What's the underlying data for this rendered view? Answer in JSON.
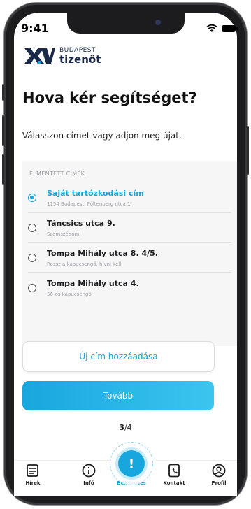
{
  "status": {
    "time": "9:41",
    "wifi_icon": "wifi-icon",
    "battery_icon": "battery-icon"
  },
  "brand": {
    "line1": "BUDAPEST",
    "line2": "tizenöt",
    "logo_colors": [
      "#1b2a4a",
      "#1aa3dc"
    ]
  },
  "page": {
    "title": "Hova kér segítséget?",
    "subtitle": "Válasszon címet vagy adjon meg újat."
  },
  "saved_addresses": {
    "header": "ELMENTETT CÍMEK",
    "items": [
      {
        "label": "Saját tartózkodási cím",
        "detail": "1154 Budapest, Pöltenberg utca 1.",
        "selected": true
      },
      {
        "label": "Táncsics utca 9.",
        "detail": "Szomszédom",
        "selected": false
      },
      {
        "label": "Tompa Mihály utca 8. 4/5.",
        "detail": "Rossz a kapucsengő, hívni kell",
        "selected": false
      },
      {
        "label": "Tompa Mihály utca 4.",
        "detail": "56-os kapucsengő",
        "selected": false
      }
    ]
  },
  "actions": {
    "add_new": "Új cím hozzáadása",
    "next": "Tovább"
  },
  "pager": {
    "current": "3",
    "total": "/4"
  },
  "tabbar": {
    "items": [
      {
        "label": "Hírek",
        "icon": "newspaper-icon"
      },
      {
        "label": "Infó",
        "icon": "info-icon"
      },
      {
        "label": "Bejelentés",
        "icon": "alert-icon",
        "active": true
      },
      {
        "label": "Kontakt",
        "icon": "phone-book-icon"
      },
      {
        "label": "Profil",
        "icon": "profile-icon"
      }
    ],
    "fab_symbol": "!"
  },
  "colors": {
    "accent": "#1aa3dc",
    "navy": "#1b2a4a",
    "panel": "#f6f6f7"
  }
}
